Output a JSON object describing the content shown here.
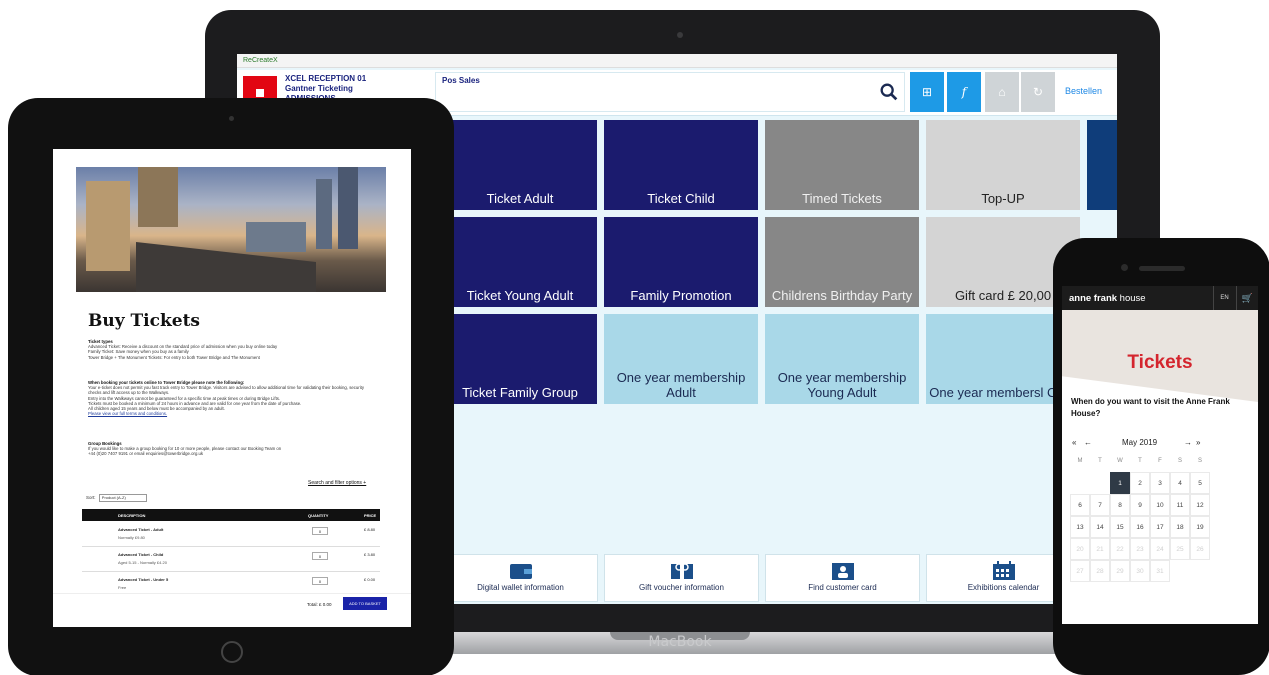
{
  "laptop": {
    "brand": "MacBook",
    "app": {
      "window_title": "ReCreateX",
      "station": [
        "XCEL RECEPTION 01",
        "Gantner Ticketing",
        "ADMISSIONS"
      ],
      "section_label": "Pos Sales",
      "order_link": "Bestellen",
      "tiles": [
        {
          "label": "Ticket Adult"
        },
        {
          "label": "Ticket Child"
        },
        {
          "label": "Timed Tickets"
        },
        {
          "label": "Top-UP"
        },
        {
          "label": "Ticket Young Adult"
        },
        {
          "label": "Family Promotion"
        },
        {
          "label": "Childrens Birthday Party"
        },
        {
          "label": "Gift card £ 20,00"
        },
        {
          "label": "Ticket Family Group"
        },
        {
          "label": "One year membership Adult"
        },
        {
          "label": "One year membership Young Adult"
        },
        {
          "label": "One year membersl Child"
        }
      ],
      "bottom_actions": [
        {
          "label": "Digital wallet information",
          "icon": "wallet-icon"
        },
        {
          "label": "Gift voucher information",
          "icon": "gift-voucher-icon"
        },
        {
          "label": "Find customer card",
          "icon": "customer-card-icon"
        },
        {
          "label": "Exhibitions calendar",
          "icon": "calendar-icon"
        }
      ]
    }
  },
  "tablet": {
    "title": "Buy Tickets",
    "ticket_types_heading": "Ticket types",
    "ticket_types_lines": [
      "Advanced Ticket: Receive a discount on the standard price of admission when you buy online today",
      "Family Ticket: Save money when you buy as a family",
      "Tower Bridge + The Monument Tickets: For entry to both Tower Bridge and The Monument"
    ],
    "booking_heading": "When booking your tickets online to Tower Bridge please note the following:",
    "booking_bullets": [
      "Your e-ticket does not permit you fast track entry to Tower Bridge. Visitors are advised to allow additional time for validating their booking, security checks and lift access up to the Walkways.",
      "Entry into the Walkways cannot be guaranteed for a specific time at peak times or during Bridge Lifts.",
      "Tickets must be booked a minimum of 24 hours in advance and are valid for one year from the date of purchase.",
      "All children aged 15 years and below must be accompanied by an adult.",
      "Please view our full terms and conditions."
    ],
    "group_heading": "Group Bookings",
    "group_lines": [
      "If you would like to make a group booking for 10 or more people, please contact our Booking Team on",
      "+44 (0)20 7407 9191 or email enquiries@towerbridge.org.uk"
    ],
    "search_filter": "Search and filter options +",
    "sort_label": "Sort:",
    "sort_value": "Product (A-Z)",
    "table_headers": [
      "DESCRIPTION",
      "QUANTITY",
      "PRICE"
    ],
    "rows": [
      {
        "name": "Advanced Ticket - Adult",
        "sub": "Normally £9.80",
        "qty": "0",
        "price": "£ 8.80"
      },
      {
        "name": "Advanced Ticket - Child",
        "sub": "Aged 5-15 - Normally £4.20",
        "qty": "0",
        "price": "£ 3.80"
      },
      {
        "name": "Advanced Ticket - Under 5",
        "sub": "Free",
        "qty": "0",
        "price": "£ 0.00"
      }
    ],
    "total_label": "Total: £ 0.00",
    "basket_button": "ADD TO BASKET"
  },
  "phone": {
    "logo_bold": "anne frank",
    "logo_rest": " house",
    "lang": "EN",
    "title": "Tickets",
    "question": "When do you want to visit the Anne Frank House?",
    "month": "May 2019",
    "weekdays": [
      "M",
      "T",
      "W",
      "T",
      "F",
      "S",
      "S"
    ],
    "weeks": [
      [
        "",
        "",
        "1",
        "2",
        "3",
        "4",
        "5"
      ],
      [
        "6",
        "7",
        "8",
        "9",
        "10",
        "11",
        "12"
      ],
      [
        "13",
        "14",
        "15",
        "16",
        "17",
        "18",
        "19"
      ],
      [
        "20",
        "21",
        "22",
        "23",
        "24",
        "25",
        "26"
      ],
      [
        "27",
        "28",
        "29",
        "30",
        "31",
        "",
        ""
      ]
    ],
    "selected_day": "1"
  },
  "colors": {
    "navy_tile": "#1b1b6e",
    "grey_tile": "#878787",
    "light_tile": "#a9d8e8",
    "toolbar_blue": "#1e9ae6",
    "brand_red": "#e20613",
    "anne_frank_red": "#d4252e"
  }
}
